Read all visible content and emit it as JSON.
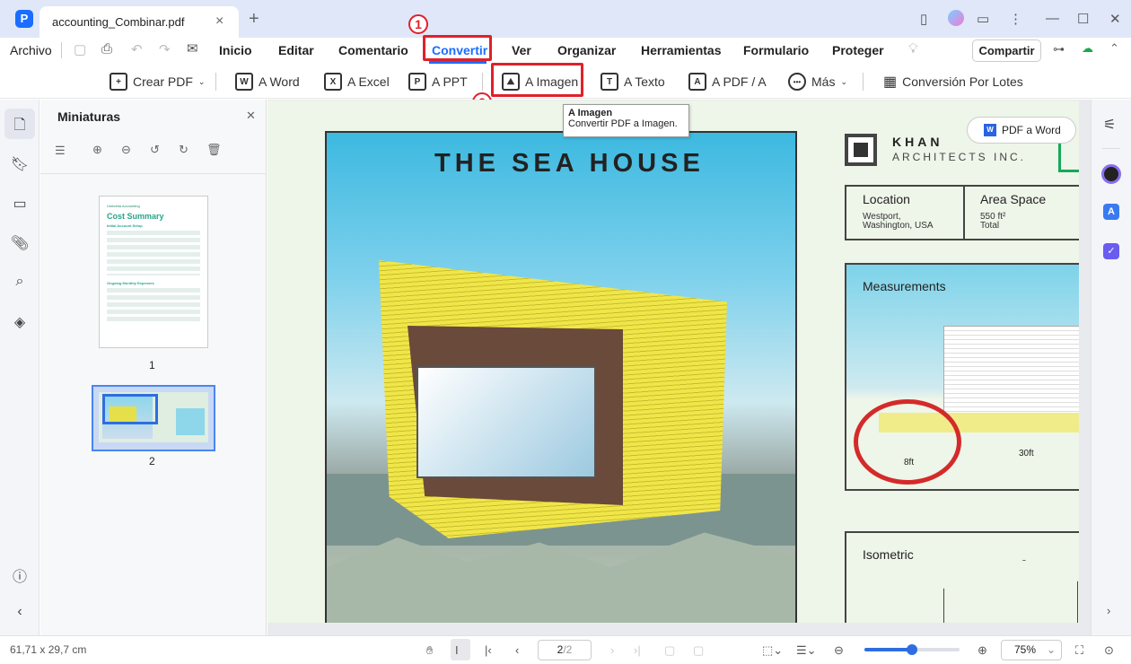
{
  "titlebar": {
    "tab_title": "accounting_Combinar.pdf",
    "close": "×",
    "new_tab": "+"
  },
  "menubar": {
    "file": "Archivo",
    "items": [
      "Inicio",
      "Editar",
      "Comentario",
      "Convertir",
      "Ver",
      "Organizar",
      "Herramientas",
      "Formulario",
      "Proteger"
    ],
    "active": "Convertir",
    "share": "Compartir"
  },
  "toolbar": {
    "items": [
      {
        "label": "Crear PDF",
        "icon": "+"
      },
      {
        "label": "A Word",
        "icon": "W"
      },
      {
        "label": "A Excel",
        "icon": "X"
      },
      {
        "label": "A PPT",
        "icon": "P"
      },
      {
        "label": "A Imagen",
        "icon": "image"
      },
      {
        "label": "A Texto",
        "icon": "T"
      },
      {
        "label": "A PDF / A",
        "icon": "A"
      },
      {
        "label": "Más",
        "icon": "•••"
      },
      {
        "label": "Conversión Por Lotes",
        "icon": "batch"
      }
    ]
  },
  "annotations": {
    "step1": "1",
    "step2": "2",
    "highlight_color": "#e0202a"
  },
  "tooltip": {
    "title": "A Imagen",
    "desc": "Convertir PDF a Imagen."
  },
  "thumbnails": {
    "title": "Miniaturas",
    "pages": [
      {
        "label": "1",
        "company": "Umbrella Accounting",
        "heading": "Cost Summary",
        "section1": "Initial Account Setup",
        "section2": "Ongoing Monthly Expenses"
      },
      {
        "label": "2"
      }
    ],
    "selected": "2"
  },
  "document": {
    "title": "THE SEA HOUSE",
    "company_line1": "KHAN",
    "company_line2": "ARCHITECTS INC.",
    "location_label": "Location",
    "location_value1": "Westport,",
    "location_value2": "Washington, USA",
    "area_label": "Area Space",
    "area_value1": "550 ft²",
    "area_value2": "Total",
    "measurements": "Measurements",
    "dim1": "8ft",
    "dim2": "30ft",
    "isometric": "Isometric",
    "pdf_to_word": "PDF a Word"
  },
  "status": {
    "dimensions": "61,71 x 29,7 cm",
    "page_current": "2",
    "page_total": "/2",
    "zoom": "75%",
    "zoom_level": 0.5
  }
}
